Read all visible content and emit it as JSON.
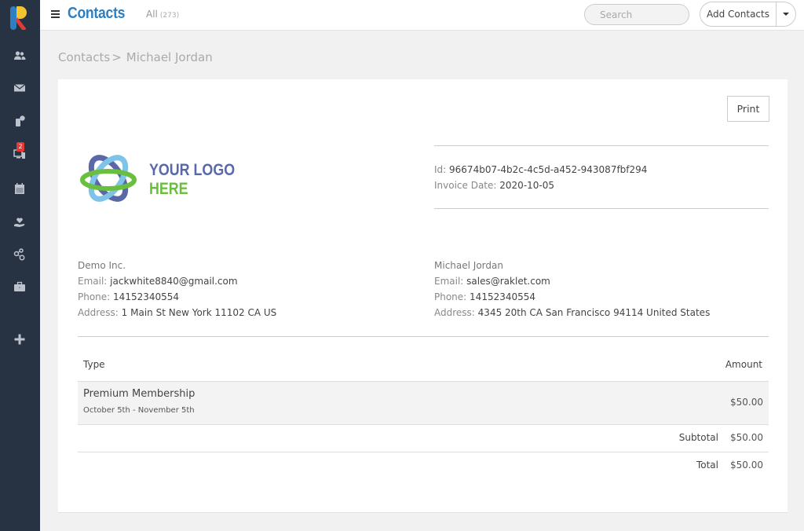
{
  "topbar": {
    "title": "Contacts",
    "filter_label": "All",
    "filter_count": "(273)",
    "search_placeholder": "Search",
    "add_button": "Add Contacts"
  },
  "sidebar": {
    "items": [
      {
        "icon": "contacts-icon"
      },
      {
        "icon": "mail-icon"
      },
      {
        "icon": "sms-icon"
      },
      {
        "icon": "devices-icon",
        "badge": "2"
      },
      {
        "icon": "calendar-icon"
      },
      {
        "icon": "donation-icon"
      },
      {
        "icon": "network-icon"
      },
      {
        "icon": "briefcase-icon"
      },
      {
        "icon": "plus-icon"
      }
    ]
  },
  "breadcrumb": {
    "parent": "Contacts",
    "separator": ">",
    "current": "Michael Jordan"
  },
  "invoice": {
    "print_label": "Print",
    "logo_line1": "YOUR LOGO",
    "logo_line2": "HERE",
    "id_label": "Id:",
    "id_value": "96674b07-4b2c-4c5d-a452-943087fbf294",
    "date_label": "Invoice Date:",
    "date_value": "2020-10-05",
    "from": {
      "name": "Demo Inc.",
      "email_label": "Email:",
      "email": "jackwhite8840@gmail.com",
      "phone_label": "Phone:",
      "phone": "14152340554",
      "address_label": "Address:",
      "address": "1 Main St New York 11102 CA US"
    },
    "to": {
      "name": "Michael Jordan",
      "email_label": "Email:",
      "email": "sales@raklet.com",
      "phone_label": "Phone:",
      "phone": "14152340554",
      "address_label": "Address:",
      "address": "4345 20th CA San Francisco 94114 United States"
    },
    "table": {
      "col_type": "Type",
      "col_amount": "Amount",
      "items": [
        {
          "name": "Premium Membership",
          "period": "October 5th - November 5th",
          "amount": "$50.00"
        }
      ],
      "subtotal_label": "Subtotal",
      "subtotal": "$50.00",
      "total_label": "Total",
      "total": "$50.00"
    }
  }
}
